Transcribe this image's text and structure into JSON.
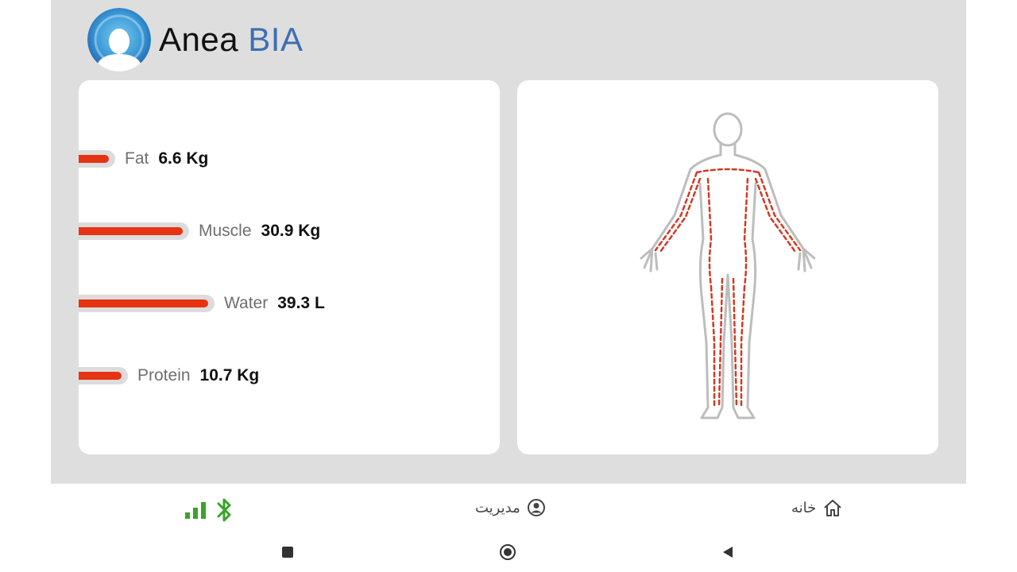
{
  "app": {
    "title_main": "Anea",
    "title_accent": "BIA"
  },
  "metrics": [
    {
      "label": "Fat",
      "value": "6.6 Kg",
      "level": 0.12
    },
    {
      "label": "Muscle",
      "value": "30.9 Kg",
      "level": 0.57
    },
    {
      "label": "Water",
      "value": "39.3 L",
      "level": 0.73
    },
    {
      "label": "Protein",
      "value": "10.7 Kg",
      "level": 0.2
    }
  ],
  "nav": {
    "manage_label": "مدیریت",
    "home_label": "خانه"
  },
  "colors": {
    "accent": "#3c6fb4",
    "bar_fill": "#e63312",
    "bar_track": "#dcdcdc",
    "status_green": "#3aa32a"
  },
  "icons": {
    "signal": "signal-bars-icon",
    "bluetooth": "bluetooth-icon",
    "manage": "user-circle-icon",
    "home": "home-icon",
    "recents": "square-icon",
    "home_system": "circle-icon",
    "back": "triangle-back-icon"
  }
}
